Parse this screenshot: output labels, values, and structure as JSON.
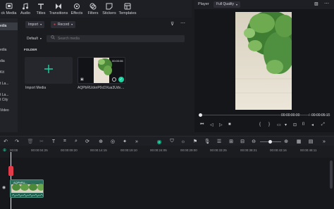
{
  "topbar": {
    "tools": [
      {
        "label": "ck Media",
        "icon": "media-icon"
      },
      {
        "label": "Audio",
        "icon": "audio-icon"
      },
      {
        "label": "Titles",
        "icon": "titles-icon"
      },
      {
        "label": "Transitions",
        "icon": "transitions-icon"
      },
      {
        "label": "Effects",
        "icon": "effects-icon"
      },
      {
        "label": "Filters",
        "icon": "filters-icon"
      },
      {
        "label": "Stickers",
        "icon": "stickers-icon"
      },
      {
        "label": "Templates",
        "icon": "templates-icon"
      }
    ]
  },
  "sidenav": {
    "items": [
      "edia",
      "edia",
      "dia",
      "Kit",
      "t La...",
      "t La...",
      "t City",
      "Video"
    ]
  },
  "media": {
    "import_label": "Import",
    "record_label": "Record",
    "default_label": "Default",
    "search_placeholder": "Search media",
    "folder_label": "FOLDER",
    "import_media_label": "Import Media",
    "clip_name": "AQPbRUcknP0cDXua3Udv....",
    "clip_duration": "00:00:06"
  },
  "player": {
    "title": "Player",
    "quality": "Full Quality",
    "current_time": "00:00:00:00",
    "total_time": "00:00:05:15"
  },
  "timeline": {
    "ruler": [
      "00:00",
      "00:00:04:25",
      "00:00:09:20",
      "00:00:14:15",
      "00:00:19:10",
      "00:00:24:05",
      "00:00:29:00",
      "00:00:33:25",
      "00:00:38:21",
      "00:00:43:16",
      "00:00:48:11"
    ],
    "clip_label": "AQPbRU..."
  },
  "colors": {
    "accent": "#1fd1a1",
    "playhead_marker": "#e23b4a",
    "clip": "#2a6d5b"
  }
}
